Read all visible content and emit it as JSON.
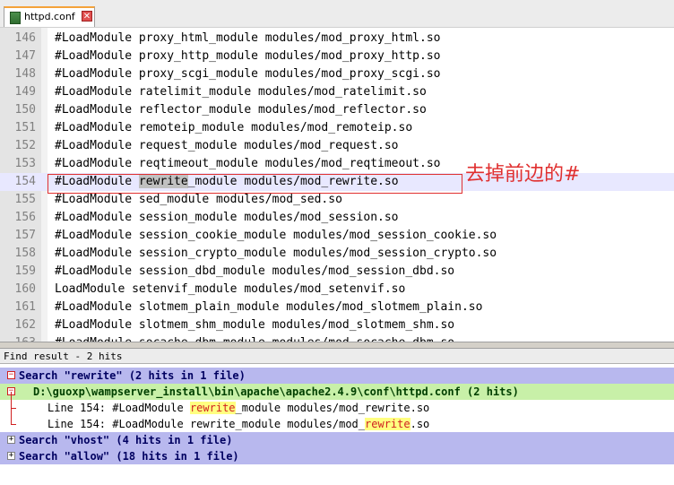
{
  "tab": {
    "name": "httpd.conf",
    "close_glyph": "✕"
  },
  "editor": {
    "current_line_index": 8,
    "lines": [
      {
        "num": "146",
        "text": "#LoadModule proxy_html_module modules/mod_proxy_html.so"
      },
      {
        "num": "147",
        "text": "#LoadModule proxy_http_module modules/mod_proxy_http.so"
      },
      {
        "num": "148",
        "text": "#LoadModule proxy_scgi_module modules/mod_proxy_scgi.so"
      },
      {
        "num": "149",
        "text": "#LoadModule ratelimit_module modules/mod_ratelimit.so"
      },
      {
        "num": "150",
        "text": "#LoadModule reflector_module modules/mod_reflector.so"
      },
      {
        "num": "151",
        "text": "#LoadModule remoteip_module modules/mod_remoteip.so"
      },
      {
        "num": "152",
        "text": "#LoadModule request_module modules/mod_request.so"
      },
      {
        "num": "153",
        "text": "#LoadModule reqtimeout_module modules/mod_reqtimeout.so"
      },
      {
        "num": "154",
        "pre": "#LoadModule ",
        "hl": "rewrite",
        "post": "_module modules/mod_rewrite.so"
      },
      {
        "num": "155",
        "text": "#LoadModule sed_module modules/mod_sed.so"
      },
      {
        "num": "156",
        "text": "#LoadModule session_module modules/mod_session.so"
      },
      {
        "num": "157",
        "text": "#LoadModule session_cookie_module modules/mod_session_cookie.so"
      },
      {
        "num": "158",
        "text": "#LoadModule session_crypto_module modules/mod_session_crypto.so"
      },
      {
        "num": "159",
        "text": "#LoadModule session_dbd_module modules/mod_session_dbd.so"
      },
      {
        "num": "160",
        "text": "LoadModule setenvif_module modules/mod_setenvif.so"
      },
      {
        "num": "161",
        "text": "#LoadModule slotmem_plain_module modules/mod_slotmem_plain.so"
      },
      {
        "num": "162",
        "text": "#LoadModule slotmem_shm_module modules/mod_slotmem_shm.so"
      },
      {
        "num": "163",
        "text": "#LoadModule socache_dbm_module modules/mod_socache_dbm.so"
      }
    ]
  },
  "annotation": {
    "text": "去掉前边的#",
    "color": "#e03030"
  },
  "find_panel": {
    "header": "Find result - 2 hits",
    "searches": [
      {
        "label": "Search \"rewrite\" (2 hits in 1 file)",
        "expanded": true,
        "file": "D:\\guoxp\\wampserver_install\\bin\\apache\\apache2.4.9\\conf\\httpd.conf (2 hits)",
        "results": [
          {
            "pre": "Line 154: #LoadModule ",
            "match": "rewrite",
            "post": "_module modules/mod_rewrite.so"
          },
          {
            "pre": "Line 154: #LoadModule rewrite_module modules/mod_",
            "match": "rewrite",
            "post": ".so"
          }
        ]
      },
      {
        "label": "Search \"vhost\" (4 hits in 1 file)",
        "expanded": false
      },
      {
        "label": "Search \"allow\" (18 hits in 1 file)",
        "expanded": false
      }
    ]
  },
  "colors": {
    "search_row": "#b8b8ee",
    "file_row": "#c8f0a8",
    "current_line": "#e8e8ff",
    "match_bg": "#ffff80"
  }
}
